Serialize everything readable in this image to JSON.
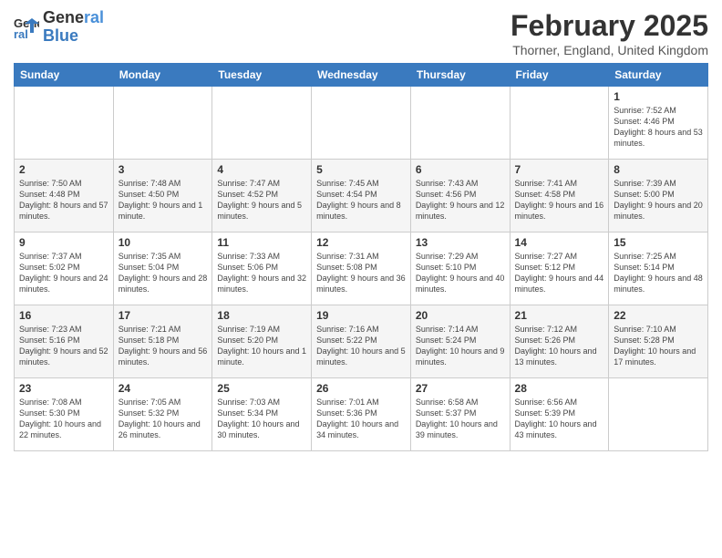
{
  "header": {
    "logo_line1": "General",
    "logo_line2": "Blue",
    "month_title": "February 2025",
    "location": "Thorner, England, United Kingdom"
  },
  "weekdays": [
    "Sunday",
    "Monday",
    "Tuesday",
    "Wednesday",
    "Thursday",
    "Friday",
    "Saturday"
  ],
  "weeks": [
    [
      {
        "day": "",
        "info": ""
      },
      {
        "day": "",
        "info": ""
      },
      {
        "day": "",
        "info": ""
      },
      {
        "day": "",
        "info": ""
      },
      {
        "day": "",
        "info": ""
      },
      {
        "day": "",
        "info": ""
      },
      {
        "day": "1",
        "info": "Sunrise: 7:52 AM\nSunset: 4:46 PM\nDaylight: 8 hours\nand 53 minutes."
      }
    ],
    [
      {
        "day": "2",
        "info": "Sunrise: 7:50 AM\nSunset: 4:48 PM\nDaylight: 8 hours\nand 57 minutes."
      },
      {
        "day": "3",
        "info": "Sunrise: 7:48 AM\nSunset: 4:50 PM\nDaylight: 9 hours\nand 1 minute."
      },
      {
        "day": "4",
        "info": "Sunrise: 7:47 AM\nSunset: 4:52 PM\nDaylight: 9 hours\nand 5 minutes."
      },
      {
        "day": "5",
        "info": "Sunrise: 7:45 AM\nSunset: 4:54 PM\nDaylight: 9 hours\nand 8 minutes."
      },
      {
        "day": "6",
        "info": "Sunrise: 7:43 AM\nSunset: 4:56 PM\nDaylight: 9 hours\nand 12 minutes."
      },
      {
        "day": "7",
        "info": "Sunrise: 7:41 AM\nSunset: 4:58 PM\nDaylight: 9 hours\nand 16 minutes."
      },
      {
        "day": "8",
        "info": "Sunrise: 7:39 AM\nSunset: 5:00 PM\nDaylight: 9 hours\nand 20 minutes."
      }
    ],
    [
      {
        "day": "9",
        "info": "Sunrise: 7:37 AM\nSunset: 5:02 PM\nDaylight: 9 hours\nand 24 minutes."
      },
      {
        "day": "10",
        "info": "Sunrise: 7:35 AM\nSunset: 5:04 PM\nDaylight: 9 hours\nand 28 minutes."
      },
      {
        "day": "11",
        "info": "Sunrise: 7:33 AM\nSunset: 5:06 PM\nDaylight: 9 hours\nand 32 minutes."
      },
      {
        "day": "12",
        "info": "Sunrise: 7:31 AM\nSunset: 5:08 PM\nDaylight: 9 hours\nand 36 minutes."
      },
      {
        "day": "13",
        "info": "Sunrise: 7:29 AM\nSunset: 5:10 PM\nDaylight: 9 hours\nand 40 minutes."
      },
      {
        "day": "14",
        "info": "Sunrise: 7:27 AM\nSunset: 5:12 PM\nDaylight: 9 hours\nand 44 minutes."
      },
      {
        "day": "15",
        "info": "Sunrise: 7:25 AM\nSunset: 5:14 PM\nDaylight: 9 hours\nand 48 minutes."
      }
    ],
    [
      {
        "day": "16",
        "info": "Sunrise: 7:23 AM\nSunset: 5:16 PM\nDaylight: 9 hours\nand 52 minutes."
      },
      {
        "day": "17",
        "info": "Sunrise: 7:21 AM\nSunset: 5:18 PM\nDaylight: 9 hours\nand 56 minutes."
      },
      {
        "day": "18",
        "info": "Sunrise: 7:19 AM\nSunset: 5:20 PM\nDaylight: 10 hours\nand 1 minute."
      },
      {
        "day": "19",
        "info": "Sunrise: 7:16 AM\nSunset: 5:22 PM\nDaylight: 10 hours\nand 5 minutes."
      },
      {
        "day": "20",
        "info": "Sunrise: 7:14 AM\nSunset: 5:24 PM\nDaylight: 10 hours\nand 9 minutes."
      },
      {
        "day": "21",
        "info": "Sunrise: 7:12 AM\nSunset: 5:26 PM\nDaylight: 10 hours\nand 13 minutes."
      },
      {
        "day": "22",
        "info": "Sunrise: 7:10 AM\nSunset: 5:28 PM\nDaylight: 10 hours\nand 17 minutes."
      }
    ],
    [
      {
        "day": "23",
        "info": "Sunrise: 7:08 AM\nSunset: 5:30 PM\nDaylight: 10 hours\nand 22 minutes."
      },
      {
        "day": "24",
        "info": "Sunrise: 7:05 AM\nSunset: 5:32 PM\nDaylight: 10 hours\nand 26 minutes."
      },
      {
        "day": "25",
        "info": "Sunrise: 7:03 AM\nSunset: 5:34 PM\nDaylight: 10 hours\nand 30 minutes."
      },
      {
        "day": "26",
        "info": "Sunrise: 7:01 AM\nSunset: 5:36 PM\nDaylight: 10 hours\nand 34 minutes."
      },
      {
        "day": "27",
        "info": "Sunrise: 6:58 AM\nSunset: 5:37 PM\nDaylight: 10 hours\nand 39 minutes."
      },
      {
        "day": "28",
        "info": "Sunrise: 6:56 AM\nSunset: 5:39 PM\nDaylight: 10 hours\nand 43 minutes."
      },
      {
        "day": "",
        "info": ""
      }
    ]
  ]
}
